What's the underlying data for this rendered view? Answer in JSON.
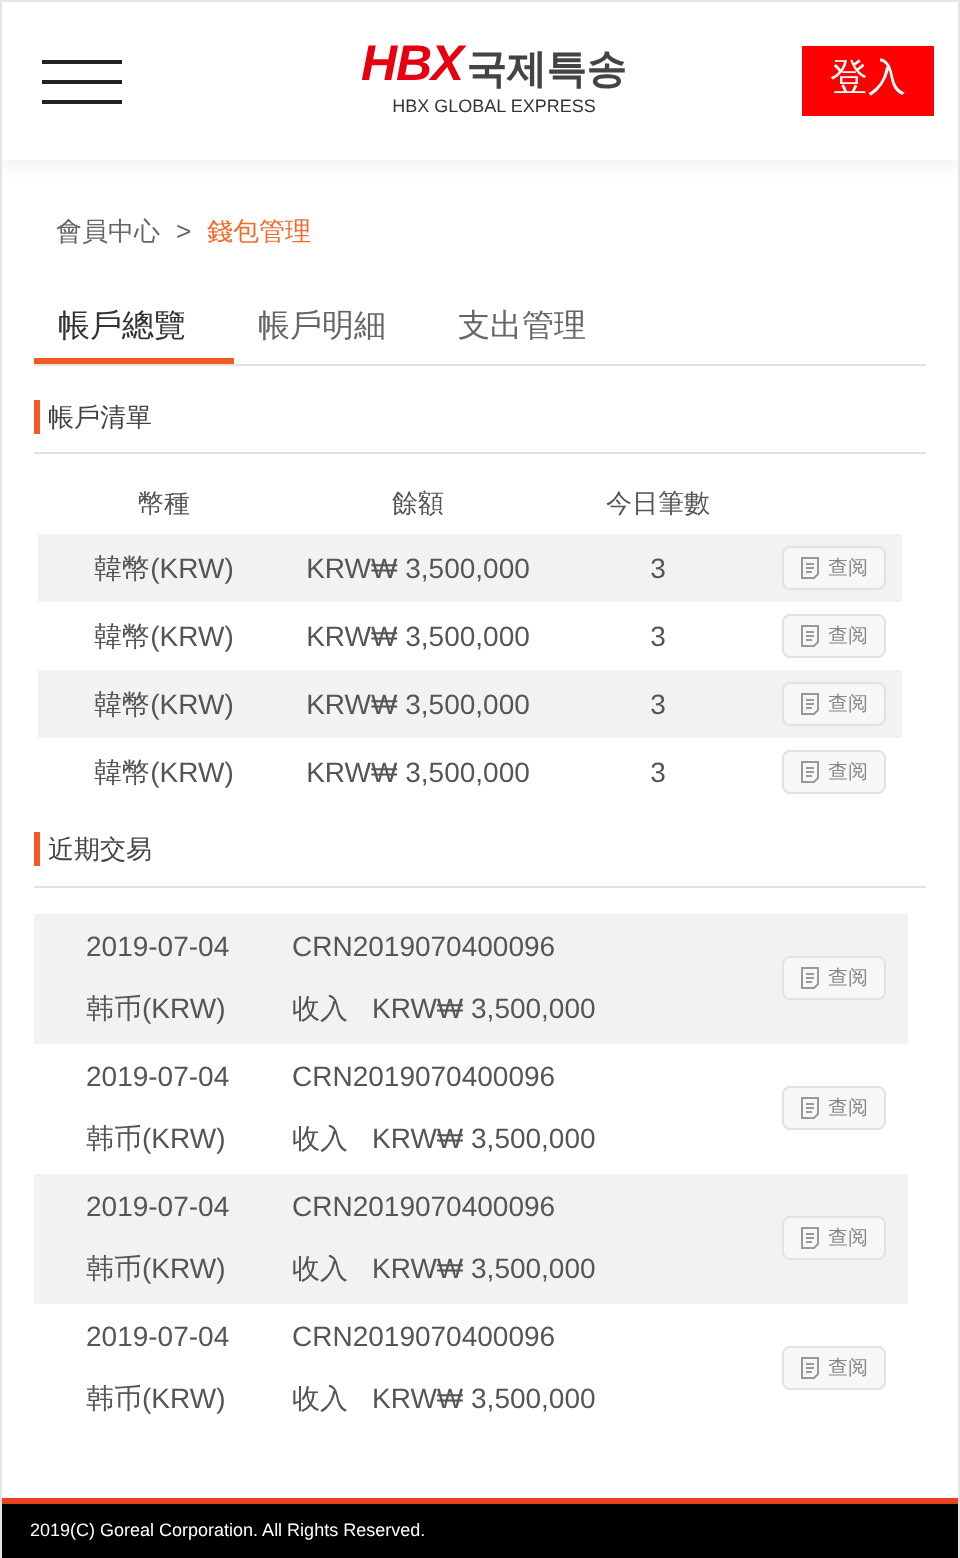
{
  "header": {
    "logo_mark": "HBX",
    "logo_text": "국제특송",
    "logo_subtitle": "HBX GLOBAL EXPRESS",
    "login_button": "登入"
  },
  "breadcrumb": {
    "parent": "會員中心",
    "separator": ">",
    "current": "錢包管理"
  },
  "tabs": [
    {
      "label": "帳戶總覽",
      "selected": true
    },
    {
      "label": "帳戶明細",
      "selected": false
    },
    {
      "label": "支出管理",
      "selected": false
    }
  ],
  "accounts": {
    "title": "帳戶清單",
    "columns": [
      "幣種",
      "餘額",
      "今日筆數"
    ],
    "rows": [
      {
        "currency": "韓幣(KRW)",
        "balance": "KRW₩ 3,500,000",
        "count": "3",
        "action": "查阅"
      },
      {
        "currency": "韓幣(KRW)",
        "balance": "KRW₩ 3,500,000",
        "count": "3",
        "action": "查阅"
      },
      {
        "currency": "韓幣(KRW)",
        "balance": "KRW₩ 3,500,000",
        "count": "3",
        "action": "查阅"
      },
      {
        "currency": "韓幣(KRW)",
        "balance": "KRW₩ 3,500,000",
        "count": "3",
        "action": "查阅"
      }
    ]
  },
  "recent": {
    "title": "近期交易",
    "rows": [
      {
        "date": "2019-07-04",
        "number": "CRN2019070400096",
        "currency": "韩币(KRW)",
        "type": "收入",
        "amount": "KRW₩ 3,500,000",
        "action": "查阅"
      },
      {
        "date": "2019-07-04",
        "number": "CRN2019070400096",
        "currency": "韩币(KRW)",
        "type": "收入",
        "amount": "KRW₩ 3,500,000",
        "action": "查阅"
      },
      {
        "date": "2019-07-04",
        "number": "CRN2019070400096",
        "currency": "韩币(KRW)",
        "type": "收入",
        "amount": "KRW₩ 3,500,000",
        "action": "查阅"
      },
      {
        "date": "2019-07-04",
        "number": "CRN2019070400096",
        "currency": "韩币(KRW)",
        "type": "收入",
        "amount": "KRW₩ 3,500,000",
        "action": "查阅"
      }
    ]
  },
  "footer": {
    "copyright": "2019(C) Goreal Corporation. All Rights Reserved."
  }
}
